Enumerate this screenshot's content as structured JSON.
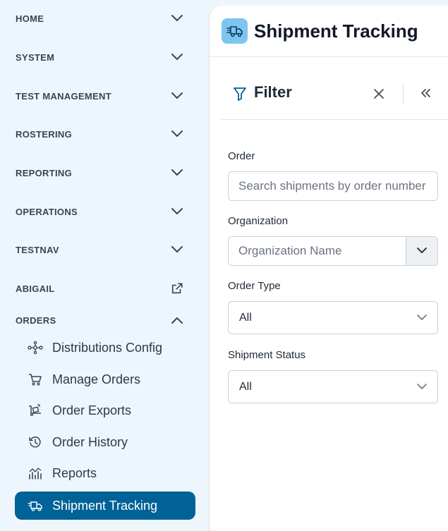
{
  "sidebar": {
    "sections": [
      {
        "label": "HOME",
        "state": "collapsed"
      },
      {
        "label": "SYSTEM",
        "state": "collapsed"
      },
      {
        "label": "TEST MANAGEMENT",
        "state": "collapsed"
      },
      {
        "label": "ROSTERING",
        "state": "collapsed"
      },
      {
        "label": "REPORTING",
        "state": "collapsed"
      },
      {
        "label": "OPERATIONS",
        "state": "collapsed"
      },
      {
        "label": "TESTNAV",
        "state": "collapsed"
      },
      {
        "label": "ABIGAIL",
        "state": "external-link"
      },
      {
        "label": "ORDERS",
        "state": "expanded"
      }
    ],
    "orders_items": [
      {
        "label": "Distributions Config",
        "icon": "distribution-icon"
      },
      {
        "label": "Manage Orders",
        "icon": "cart-icon"
      },
      {
        "label": "Order Exports",
        "icon": "export-icon"
      },
      {
        "label": "Order History",
        "icon": "history-icon"
      },
      {
        "label": "Reports",
        "icon": "reports-icon"
      },
      {
        "label": "Shipment Tracking",
        "icon": "truck-icon",
        "active": true
      }
    ]
  },
  "header": {
    "title": "Shipment Tracking",
    "icon": "truck-icon"
  },
  "filter": {
    "title": "Filter",
    "order": {
      "label": "Order",
      "placeholder": "Search shipments by order number"
    },
    "organization": {
      "label": "Organization",
      "placeholder": "Organization Name"
    },
    "order_type": {
      "label": "Order Type",
      "value": "All"
    },
    "shipment_status": {
      "label": "Shipment Status",
      "value": "All"
    }
  },
  "colors": {
    "active_nav": "#006296",
    "sidebar_bg": "#eef6fd",
    "app_icon_bg": "#7cc6ef"
  }
}
